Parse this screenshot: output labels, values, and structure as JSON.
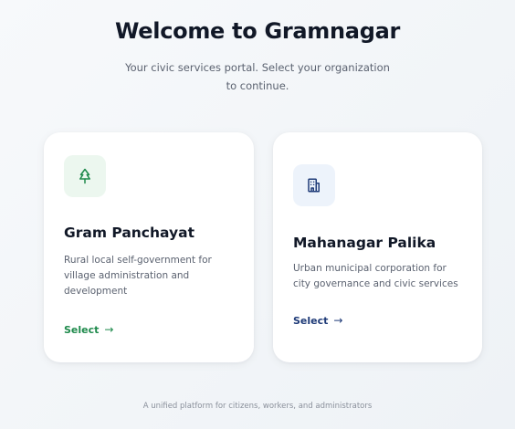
{
  "header": {
    "title": "Welcome to Gramnagar",
    "subtitle": "Your civic services portal. Select your organization to continue."
  },
  "organizations": [
    {
      "icon": "tree-icon",
      "accent": "#1f8a4c",
      "icon_bg": "#ecf7ef",
      "title": "Gram Panchayat",
      "description": "Rural local self-government for village administration and development",
      "select_label": "Select",
      "arrow": "→"
    },
    {
      "icon": "building-icon",
      "accent": "#1f3b78",
      "icon_bg": "#edf3fb",
      "title": "Mahanagar Palika",
      "description": "Urban municipal corporation for city governance and civic services",
      "select_label": "Select",
      "arrow": "→"
    }
  ],
  "footer": {
    "text": "A unified platform for citizens, workers, and administrators"
  }
}
